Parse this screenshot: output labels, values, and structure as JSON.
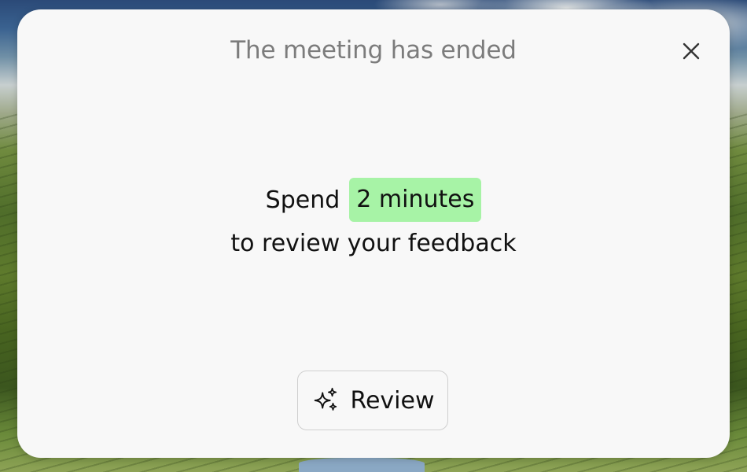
{
  "dialog": {
    "title": "The meeting has ended",
    "close_icon": "close-icon",
    "message": {
      "prefix": "Spend",
      "highlight": "2 minutes",
      "line2": "to review your feedback"
    },
    "review_button": {
      "icon": "sparkles-icon",
      "label": "Review"
    }
  },
  "colors": {
    "dialog_background": "#f8f8f8",
    "title_text": "#7c7c7c",
    "highlight_background": "#a7f3a6",
    "body_text": "#111111",
    "button_border": "#cfcfcf"
  }
}
